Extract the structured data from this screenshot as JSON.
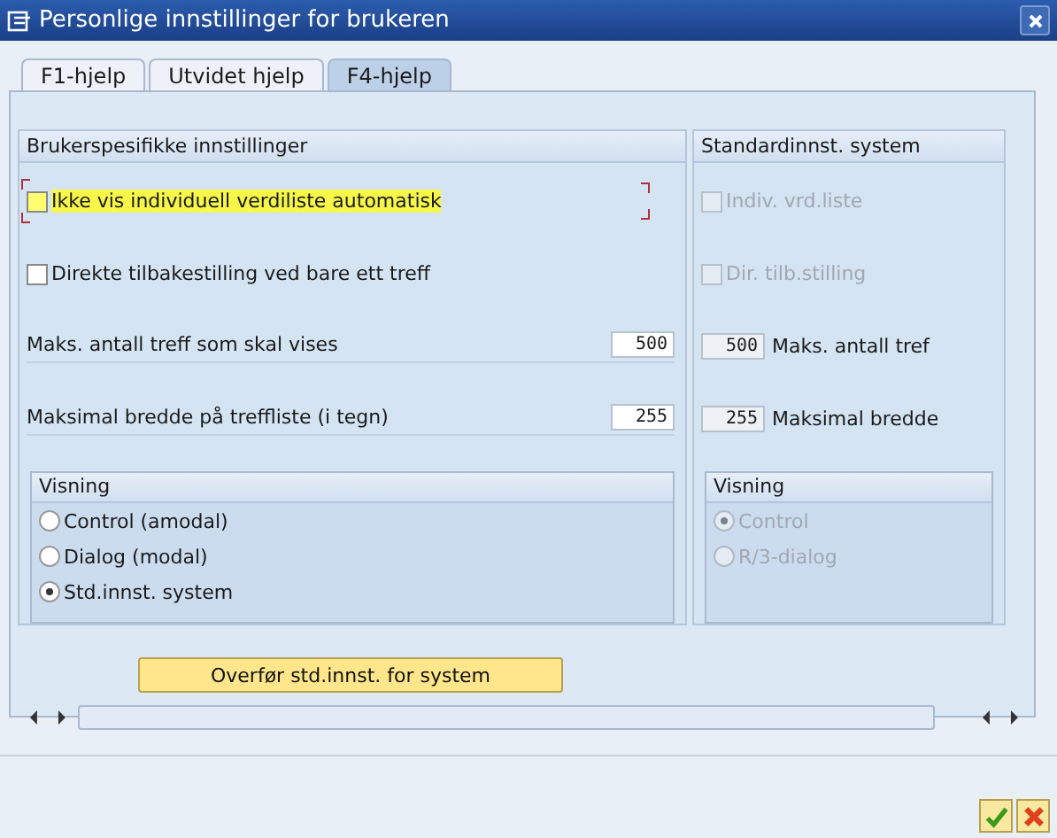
{
  "window": {
    "title": "Personlige innstillinger for brukeren"
  },
  "tabs": [
    {
      "label": "F1-hjelp",
      "selected": false
    },
    {
      "label": "Utvidet hjelp",
      "selected": false
    },
    {
      "label": "F4-hjelp",
      "selected": true
    }
  ],
  "user_settings": {
    "title": "Brukerspesifikke innstillinger",
    "options": [
      {
        "kind": "checkbox",
        "label": "Ikke vis individuell verdiliste automatisk",
        "checked": false,
        "disabled": false,
        "focused": true
      },
      {
        "kind": "checkbox",
        "label": "Direkte tilbakestilling ved bare ett treff",
        "checked": false,
        "disabled": false,
        "focused": false
      },
      {
        "kind": "number",
        "label": "Maks. antall treff som skal vises",
        "value": "500",
        "disabled": false
      },
      {
        "kind": "number",
        "label": "Maksimal bredde på treffliste (i tegn)",
        "value": "255",
        "disabled": false
      }
    ],
    "display": {
      "title": "Visning",
      "options": [
        {
          "label": "Control (amodal)",
          "selected": false,
          "disabled": false
        },
        {
          "label": "Dialog (modal)",
          "selected": false,
          "disabled": false
        },
        {
          "label": "Std.innst. system",
          "selected": true,
          "disabled": false
        }
      ]
    }
  },
  "system_defaults": {
    "title": "Standardinnst. system",
    "options": [
      {
        "kind": "checkbox",
        "label": "Indiv. vrd.liste",
        "checked": false,
        "disabled": true,
        "focused": false
      },
      {
        "kind": "checkbox",
        "label": "Dir. tilb.stilling",
        "checked": false,
        "disabled": true,
        "focused": false
      },
      {
        "kind": "number",
        "label": "Maks. antall tref",
        "value": "500",
        "disabled": true
      },
      {
        "kind": "number",
        "label": "Maksimal bredde",
        "value": "255",
        "disabled": true
      }
    ],
    "display": {
      "title": "Visning",
      "options": [
        {
          "label": "Control",
          "selected": true,
          "disabled": true
        },
        {
          "label": "R/3-dialog",
          "selected": false,
          "disabled": true
        }
      ]
    }
  },
  "transfer_button": {
    "label": "Overfør std.innst. for system"
  }
}
